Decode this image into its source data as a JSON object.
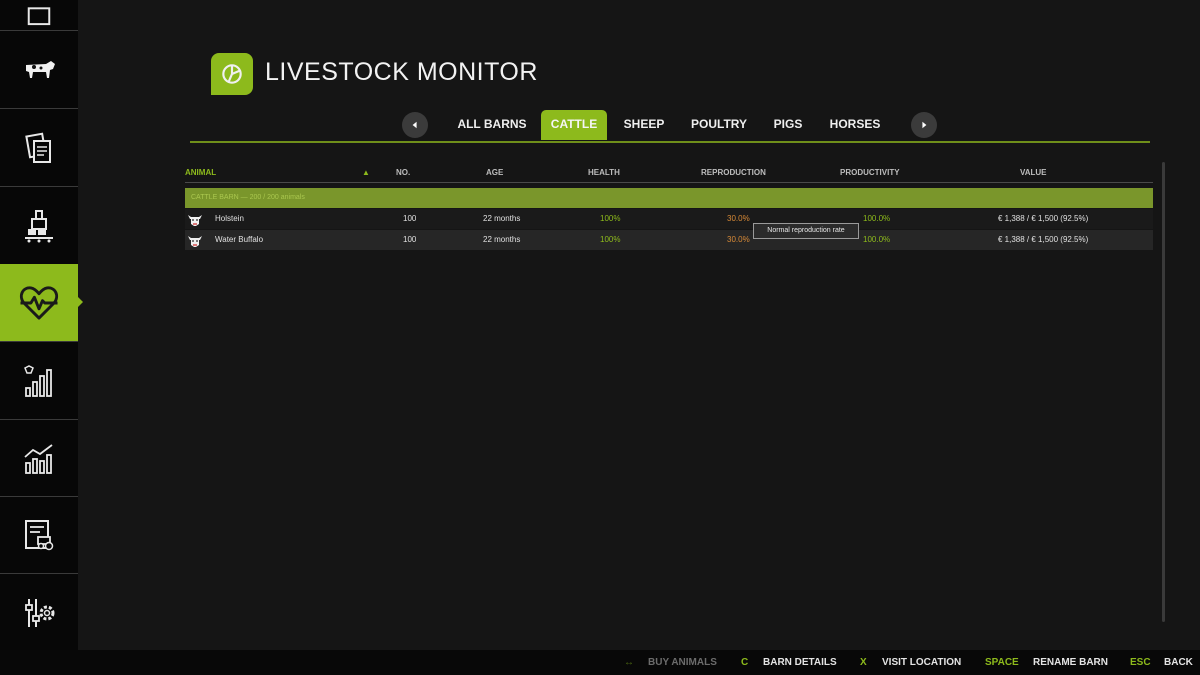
{
  "header": {
    "title": "LIVESTOCK MONITOR"
  },
  "colors": {
    "accent": "#8dba1c",
    "positive": "#8dba1c",
    "warning": "#d88a37",
    "background": "#151515"
  },
  "sidebar": {
    "items": [
      {
        "icon": "map-icon"
      },
      {
        "icon": "cow-icon"
      },
      {
        "icon": "contracts-icon"
      },
      {
        "icon": "production-icon"
      },
      {
        "icon": "heartbeat-icon",
        "active": true
      },
      {
        "icon": "prices-chart-icon"
      },
      {
        "icon": "statistics-chart-icon"
      },
      {
        "icon": "vehicle-list-icon"
      },
      {
        "icon": "settings-icon"
      }
    ]
  },
  "tabs": [
    "ALL BARNS",
    "CATTLE",
    "SHEEP",
    "POULTRY",
    "PIGS",
    "HORSES"
  ],
  "active_tab": "CATTLE",
  "table": {
    "columns": [
      "ANIMAL",
      "NO.",
      "AGE",
      "HEALTH",
      "REPRODUCTION",
      "PRODUCTIVITY",
      "VALUE"
    ],
    "sort_indicator": "▲",
    "group": {
      "label": "CATTLE BARN  —  200 / 200 animals"
    },
    "rows": [
      {
        "icon": "cow-head-icon",
        "animal": "Holstein",
        "no": "100",
        "age": "22 months",
        "health": "100%",
        "reproduction": "30.0%",
        "productivity": "100.0%",
        "value": "€ 1,388 / € 1,500 (92.5%)"
      },
      {
        "icon": "cow-head-icon",
        "animal": "Water Buffalo",
        "no": "100",
        "age": "22 months",
        "health": "100%",
        "reproduction": "30.0%",
        "productivity": "100.0%",
        "value": "€ 1,388 / € 1,500 (92.5%)"
      }
    ]
  },
  "tooltip": {
    "text": "Normal reproduction rate"
  },
  "footer": {
    "actions": [
      {
        "key": "↔",
        "label": "BUY ANIMALS",
        "enabled": false
      },
      {
        "key": "C",
        "label": "BARN DETAILS",
        "enabled": true
      },
      {
        "key": "X",
        "label": "VISIT LOCATION",
        "enabled": true
      },
      {
        "key": "SPACE",
        "label": "RENAME BARN",
        "enabled": true
      },
      {
        "key": "ESC",
        "label": "BACK",
        "enabled": true
      }
    ]
  }
}
